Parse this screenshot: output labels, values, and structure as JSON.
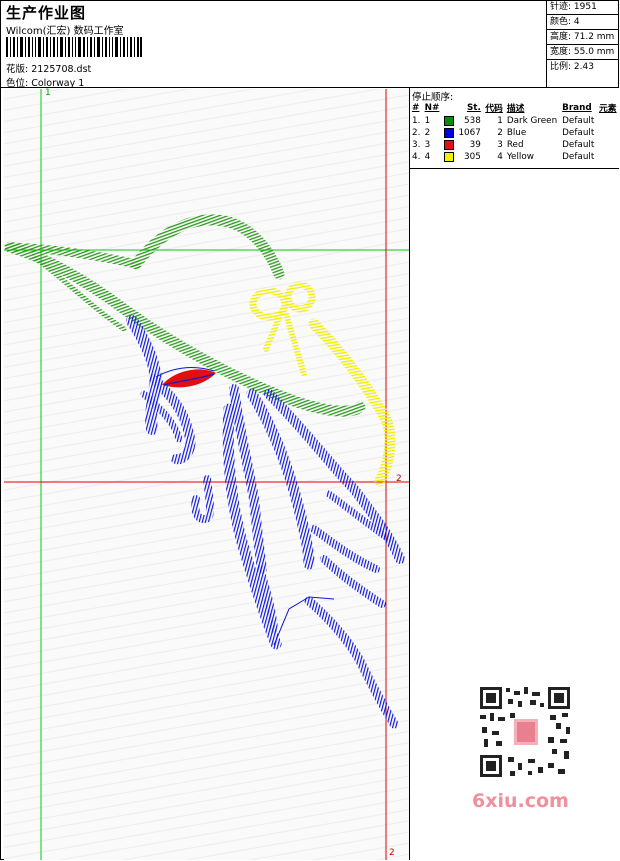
{
  "header": {
    "title": "生产作业图",
    "studio": "Wilcom(汇宏) 数码工作室",
    "design_label": "花版: 2125708.dst",
    "colorway_label": "色位:  Colorway 1"
  },
  "stats": {
    "stitches": "针迹: 1951",
    "colors": "颜色: 4",
    "height": "高度: 71.2 mm",
    "width": "宽度: 55.0 mm",
    "scale": "比例: 2.43"
  },
  "stop_sequence": {
    "title": "停止顺序:",
    "headers": {
      "num": "#",
      "n": "N#",
      "st": "St.",
      "code": "代码",
      "desc": "描述",
      "brand": "Brand",
      "element": "元素"
    },
    "rows": [
      {
        "num": "1.",
        "n": "1",
        "color": "#0a8a0a",
        "st": "538",
        "code": "1",
        "desc": "Dark Green",
        "brand": "Default"
      },
      {
        "num": "2.",
        "n": "2",
        "color": "#0000e0",
        "st": "1067",
        "code": "2",
        "desc": "Blue",
        "brand": "Default"
      },
      {
        "num": "3.",
        "n": "3",
        "color": "#e01010",
        "st": "39",
        "code": "3",
        "desc": "Red",
        "brand": "Default"
      },
      {
        "num": "4.",
        "n": "4",
        "color": "#f0f000",
        "st": "305",
        "code": "4",
        "desc": "Yellow",
        "brand": "Default"
      }
    ]
  },
  "guides": {
    "v1": "1",
    "h2": "2",
    "v2": "2"
  },
  "watermark": "6xiu.com",
  "stitch_colors": {
    "green": "#2a9a1a",
    "blue": "#1018d8",
    "red": "#e01010",
    "yellow": "#f2f000"
  }
}
